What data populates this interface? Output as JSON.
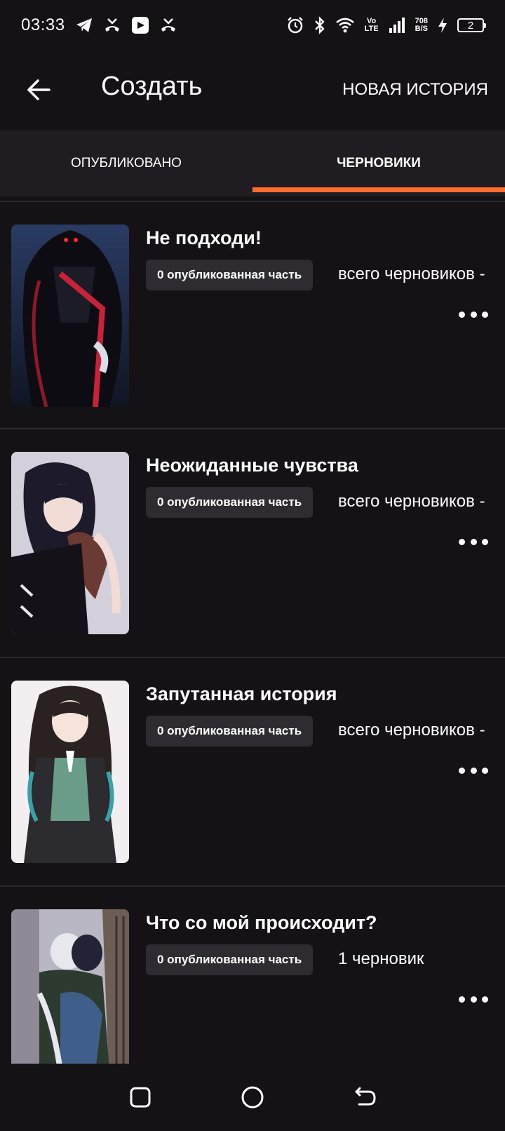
{
  "status_bar": {
    "time": "03:33",
    "net_speed_value": "708",
    "net_speed_unit": "B/S",
    "volte_top": "Vo",
    "volte_bottom": "LTE",
    "battery": "2"
  },
  "header": {
    "title": "Создать",
    "new_story_label": "НОВАЯ ИСТОРИЯ"
  },
  "tabs": [
    {
      "label": "ОПУБЛИКОВАНО",
      "active": false
    },
    {
      "label": "ЧЕРНОВИКИ",
      "active": true
    }
  ],
  "stories": [
    {
      "title": "Не подходи!",
      "published": "0 опубликованная часть",
      "drafts": "всего черновиков -"
    },
    {
      "title": "Неожиданные чувства",
      "published": "0 опубликованная часть",
      "drafts": "всего черновиков -"
    },
    {
      "title": "Запутанная история",
      "published": "0 опубликованная часть",
      "drafts": "всего черновиков -"
    },
    {
      "title": "Что со мой происходит?",
      "published": "0 опубликованная часть",
      "drafts": "1 черновик"
    }
  ],
  "colors": {
    "background": "#141215",
    "tab_bar": "#1f1d21",
    "accent": "#ff6c2f",
    "badge": "#2e2c30"
  },
  "icons": {
    "back": "arrow-left-icon",
    "more": "more-horizontal-icon",
    "nav_recents": "square-icon",
    "nav_home": "circle-icon",
    "nav_back": "back-arrow-icon"
  }
}
